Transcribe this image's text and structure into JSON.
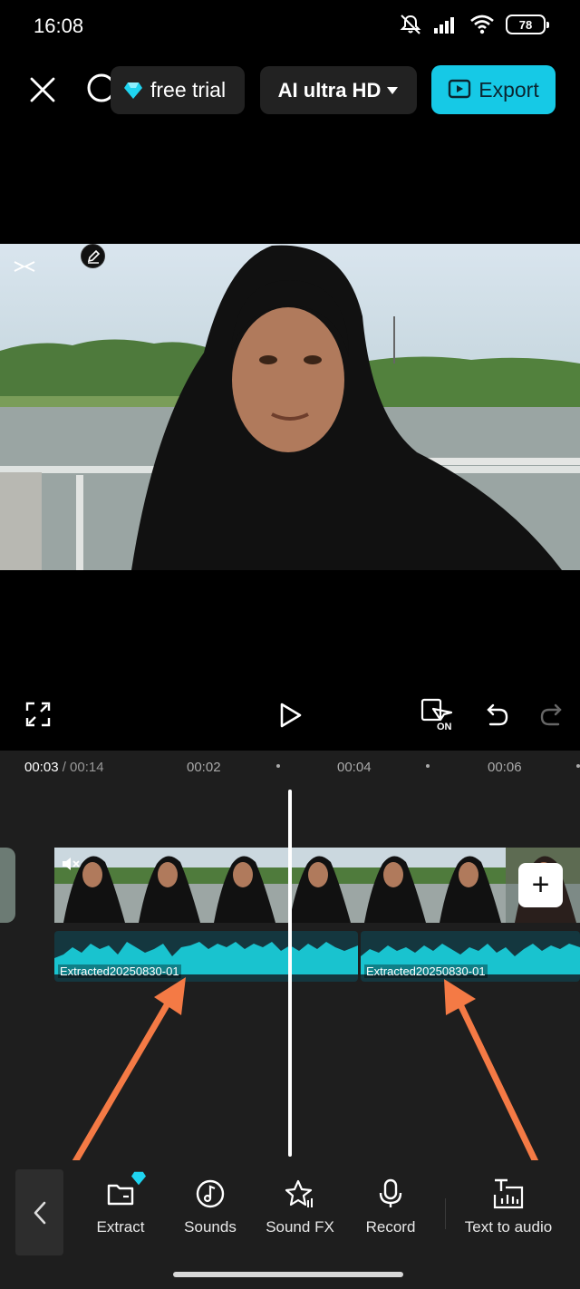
{
  "status": {
    "time": "16:08",
    "battery": "78",
    "icons": [
      "mute-bell-icon",
      "signal-icon",
      "wifi-icon",
      "battery-icon"
    ]
  },
  "header": {
    "close_icon": "close-icon",
    "search_icon": "search-icon",
    "trial_label": "free trial",
    "quality_label": "AI ultra HD",
    "export_label": "Export"
  },
  "controls": {
    "fullscreen_icon": "fullscreen-icon",
    "play_icon": "play-icon",
    "keyframe_icon": "keyframe-on-icon",
    "keyframe_label": "ON",
    "undo_icon": "undo-icon",
    "redo_icon": "redo-icon"
  },
  "timeline": {
    "current_time": "00:03",
    "total_time": " / 00:14",
    "ticks": [
      "00:02",
      "00:04",
      "00:06"
    ],
    "audio_clips": [
      {
        "label": "Extracted20250830-01"
      },
      {
        "label": "Extracted20250830-01"
      }
    ],
    "add_label": "+"
  },
  "bottom_toolbar": {
    "back_icon": "chevron-left-icon",
    "tools": [
      {
        "label": "Extract",
        "icon": "folder-icon"
      },
      {
        "label": "Sounds",
        "icon": "music-note-icon"
      },
      {
        "label": "Sound FX",
        "icon": "star-sparkle-icon"
      },
      {
        "label": "Record",
        "icon": "microphone-icon"
      },
      {
        "label": "Text to audio",
        "icon": "text-to-audio-icon"
      }
    ]
  },
  "colors": {
    "accent": "#16c9e6",
    "audio_wave": "#19c3cf",
    "arrow": "#f47a45"
  }
}
